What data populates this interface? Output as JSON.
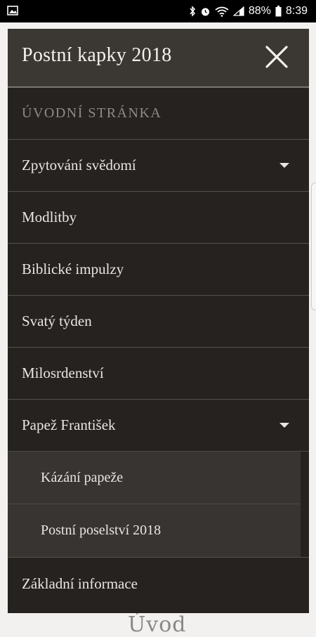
{
  "statusbar": {
    "battery": "88%",
    "time": "8:39",
    "icons": [
      "image-icon",
      "bluetooth-icon",
      "alarm-icon",
      "wifi-icon",
      "signal-icon",
      "battery-icon"
    ]
  },
  "drawer": {
    "title": "Postní kapky 2018",
    "items": [
      {
        "label": "ÚVODNÍ STRÁNKA"
      },
      {
        "label": "Zpytování svědomí"
      },
      {
        "label": "Modlitby"
      },
      {
        "label": "Biblické impulzy"
      },
      {
        "label": "Svatý týden"
      },
      {
        "label": "Milosrdenství"
      },
      {
        "label": "Papež František"
      }
    ],
    "subitems": [
      {
        "label": "Kázání papeže"
      },
      {
        "label": "Postní poselství 2018"
      }
    ],
    "footer_item": {
      "label": "Základní informace"
    }
  },
  "page": {
    "behind_text": "Úvod"
  },
  "colors": {
    "drawer_bg": "#25221f",
    "header_bg": "#3b3834",
    "sub_bg": "#373431"
  }
}
